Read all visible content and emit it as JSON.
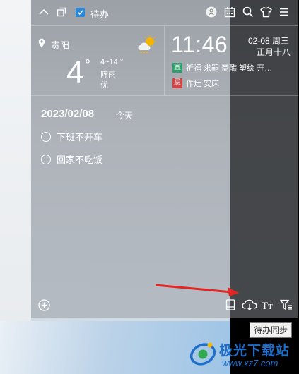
{
  "topbar": {
    "todo_label": "待办",
    "icons": [
      "collapse-icon",
      "window-icon",
      "todo-checkbox-icon",
      "user-icon",
      "calendar-icon",
      "search-icon",
      "skin-icon",
      "menu-icon"
    ]
  },
  "weather": {
    "city": "贵阳",
    "temperature": "4",
    "degree": "°",
    "range": "4~14 °",
    "condition": "阵雨",
    "air_quality": "优"
  },
  "clock": {
    "time": "11:46",
    "date": "02-08 周三",
    "lunar": "正月十八",
    "good_tag": "宜",
    "good_text": "祈福 求嗣 斋醮 塑绘 开…",
    "bad_tag": "忌",
    "bad_text": "作灶 安床"
  },
  "todo_list": {
    "date": "2023/02/08",
    "today_label": "今天",
    "tasks": [
      {
        "text": "下班不开车"
      },
      {
        "text": "回家不吃饭"
      }
    ]
  },
  "tooltip": "待办同步",
  "watermark": {
    "brand": "极光下载站",
    "url": "www.xz7.com"
  },
  "colors": {
    "good_tag": "#2e9e6b",
    "bad_tag": "#d14444",
    "checkbox": "#2b88d8",
    "arrow": "#e52424",
    "brand": "#1d6fc9"
  }
}
